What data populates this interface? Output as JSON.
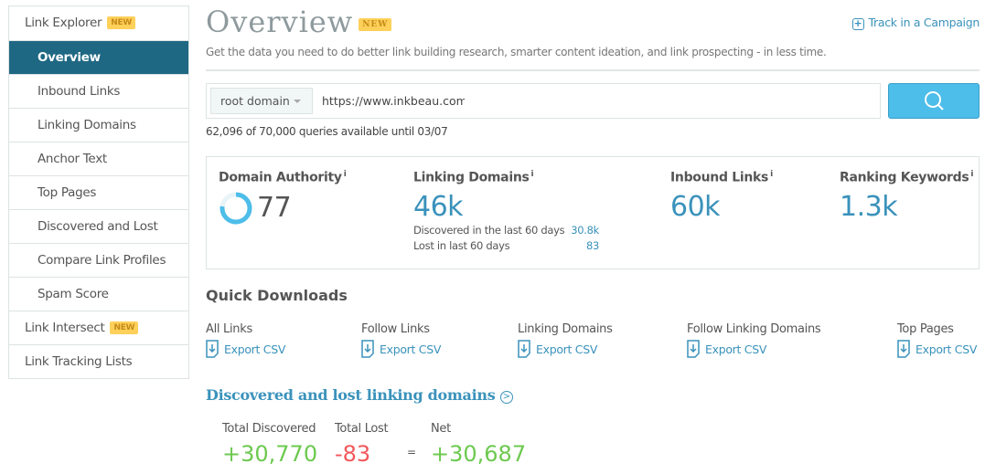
{
  "sidebar": {
    "items": [
      {
        "label": "Link Explorer",
        "badge": "NEW"
      },
      {
        "label": "Overview"
      },
      {
        "label": "Inbound Links"
      },
      {
        "label": "Linking Domains"
      },
      {
        "label": "Anchor Text"
      },
      {
        "label": "Top Pages"
      },
      {
        "label": "Discovered and Lost"
      },
      {
        "label": "Compare Link Profiles"
      },
      {
        "label": "Spam Score"
      },
      {
        "label": "Link Intersect",
        "badge": "NEW"
      },
      {
        "label": "Link Tracking Lists"
      }
    ]
  },
  "header": {
    "title": "Overview",
    "badge": "NEW",
    "subtitle": "Get the data you need to do better link building research, smarter content ideation, and link prospecting - in less time.",
    "track": "Track in a Campaign"
  },
  "search": {
    "scope": "root domain",
    "url": "https://www.inkbeau.com/",
    "quota": "62,096 of 70,000 queries available until 03/07"
  },
  "metrics": {
    "da": {
      "label": "Domain Authority",
      "value": "77",
      "percent": 77
    },
    "ld": {
      "label": "Linking Domains",
      "value": "46k",
      "discovered_label": "Discovered in the last 60 days",
      "discovered": "30.8k",
      "lost_label": "Lost in last 60 days",
      "lost": "83"
    },
    "il": {
      "label": "Inbound Links",
      "value": "60k"
    },
    "rk": {
      "label": "Ranking Keywords",
      "value": "1.3k"
    },
    "info": "i"
  },
  "downloads": {
    "title": "Quick Downloads",
    "export": "Export CSV",
    "items": [
      "All Links",
      "Follow Links",
      "Linking Domains",
      "Follow Linking Domains",
      "Top Pages"
    ]
  },
  "dl": {
    "title": "Discovered and lost linking domains",
    "discovered_label": "Total Discovered",
    "discovered": "+30,770",
    "lost_label": "Total Lost",
    "lost": "-83",
    "eq": "=",
    "net_label": "Net",
    "net": "+30,687"
  },
  "colors": {
    "accent": "#3a92bb",
    "active": "#1f6883",
    "badge": "#ffd05a",
    "green": "#6cc94f",
    "red": "#f2575a"
  }
}
